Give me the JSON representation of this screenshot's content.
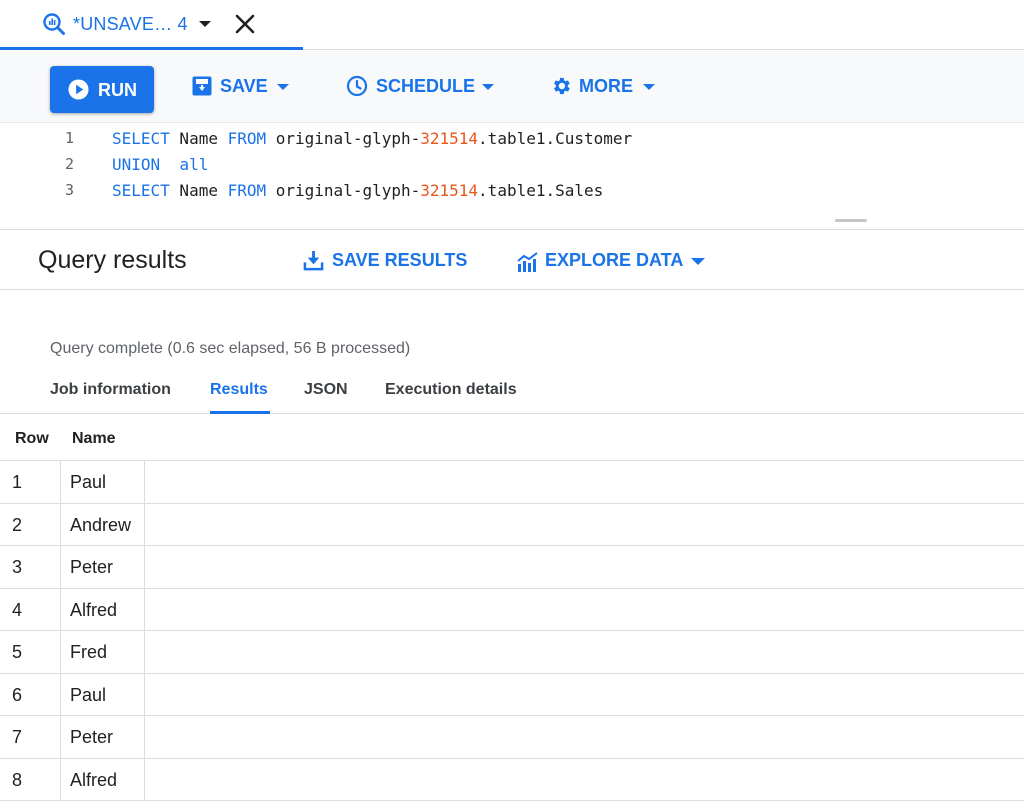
{
  "tab": {
    "title": "*UNSAVE… 4"
  },
  "toolbar": {
    "run_label": "RUN",
    "save_label": "SAVE",
    "schedule_label": "SCHEDULE",
    "more_label": "MORE"
  },
  "editor": {
    "lines": [
      {
        "number": "1",
        "kw1": "SELECT",
        "t1": " Name ",
        "kw2": "FROM",
        "t2": " original-glyph-",
        "num": "321514",
        "t3": ".table1.Customer"
      },
      {
        "number": "2",
        "kw1": "UNION",
        "t1": "  ",
        "kw2": "all",
        "t2": "",
        "num": "",
        "t3": ""
      },
      {
        "number": "3",
        "kw1": "SELECT",
        "t1": " Name ",
        "kw2": "FROM",
        "t2": " original-glyph-",
        "num": "321514",
        "t3": ".table1.Sales"
      }
    ]
  },
  "results": {
    "title": "Query results",
    "save_results_label": "SAVE RESULTS",
    "explore_data_label": "EXPLORE DATA",
    "status": "Query complete (0.6 sec elapsed, 56 B processed)",
    "tabs": [
      "Job information",
      "Results",
      "JSON",
      "Execution details"
    ],
    "active_tab": "Results"
  },
  "table": {
    "columns": [
      "Row",
      "Name"
    ],
    "rows": [
      {
        "row": "1",
        "name": "Paul"
      },
      {
        "row": "2",
        "name": "Andrew"
      },
      {
        "row": "3",
        "name": "Peter"
      },
      {
        "row": "4",
        "name": "Alfred"
      },
      {
        "row": "5",
        "name": "Fred"
      },
      {
        "row": "6",
        "name": "Paul"
      },
      {
        "row": "7",
        "name": "Peter"
      },
      {
        "row": "8",
        "name": "Alfred"
      }
    ]
  },
  "colors": {
    "accent": "#1a73e8",
    "number_literal": "#e8561a",
    "border": "#dadce0"
  },
  "icons": [
    "query-icon",
    "close-icon",
    "play-icon",
    "save-icon",
    "schedule-icon",
    "gear-icon",
    "download-icon",
    "explore-chart-icon"
  ]
}
